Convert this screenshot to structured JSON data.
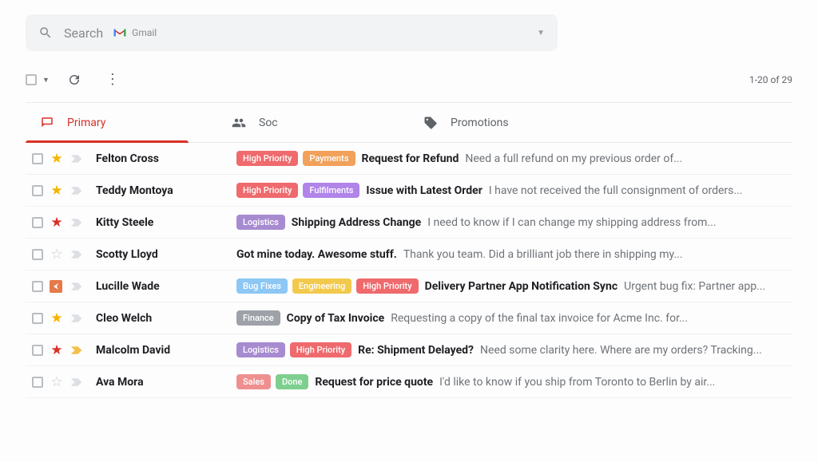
{
  "search": {
    "placeholder": "Search",
    "scope": "Gmail"
  },
  "toolbar": {
    "range": "1-20 of 29"
  },
  "tabs": [
    {
      "label": "Primary"
    },
    {
      "label": "Soc"
    },
    {
      "label": "Promotions"
    }
  ],
  "labelColors": {
    "High Priority": "#ef6a6d",
    "Payments": "#f1a15a",
    "Fulfilments": "#b084e8",
    "Logistics": "#a78bd0",
    "Bug Fixes": "#8cc7f5",
    "Engineering": "#f2c94c",
    "Finance": "#9ea2a8",
    "Sales": "#ef8f8f",
    "Done": "#7ecf8f"
  },
  "rows": [
    {
      "unread": true,
      "star": "gold",
      "important": "none",
      "sender": "Felton Cross",
      "labels": [
        "High Priority",
        "Payments"
      ],
      "subject": "Request for Refund",
      "snippet": "Need a full refund on my previous order of..."
    },
    {
      "unread": true,
      "star": "gold",
      "important": "none",
      "sender": "Teddy Montoya",
      "labels": [
        "High Priority",
        "Fulfilments"
      ],
      "subject": "Issue with Latest Order",
      "snippet": "I have not received the full consignment of orders..."
    },
    {
      "unread": true,
      "star": "red",
      "important": "none",
      "sender": "Kitty Steele",
      "labels": [
        "Logistics"
      ],
      "subject": "Shipping Address Change",
      "snippet": "I need to know if I can change my shipping address from..."
    },
    {
      "unread": true,
      "star": "none",
      "important": "none",
      "sender": "Scotty Lloyd",
      "labels": [],
      "subject": "Got mine today. Awesome stuff.",
      "snippet": "Thank you team. Did a brilliant job there in shipping my..."
    },
    {
      "unread": true,
      "star": "box",
      "important": "none",
      "sender": "Lucille Wade",
      "labels": [
        "Bug Fixes",
        "Engineering",
        "High Priority"
      ],
      "subject": "Delivery Partner App Notification Sync",
      "snippet": "Urgent bug fix: Partner app..."
    },
    {
      "unread": true,
      "star": "gold",
      "important": "none",
      "sender": "Cleo Welch",
      "labels": [
        "Finance"
      ],
      "subject": "Copy of Tax Invoice",
      "snippet": "Requesting a copy of the final tax invoice for Acme Inc. for..."
    },
    {
      "unread": true,
      "star": "red",
      "important": "yellow",
      "sender": "Malcolm David",
      "labels": [
        "Logistics",
        "High Priority"
      ],
      "subject": "Re: Shipment Delayed?",
      "snippet": "Need some clarity here. Where are my orders? Tracking..."
    },
    {
      "unread": true,
      "star": "none",
      "important": "none",
      "sender": "Ava Mora",
      "labels": [
        "Sales",
        "Done"
      ],
      "subject": "Request for price quote",
      "snippet": "I'd like to know if you ship from Toronto to Berlin by air..."
    }
  ]
}
